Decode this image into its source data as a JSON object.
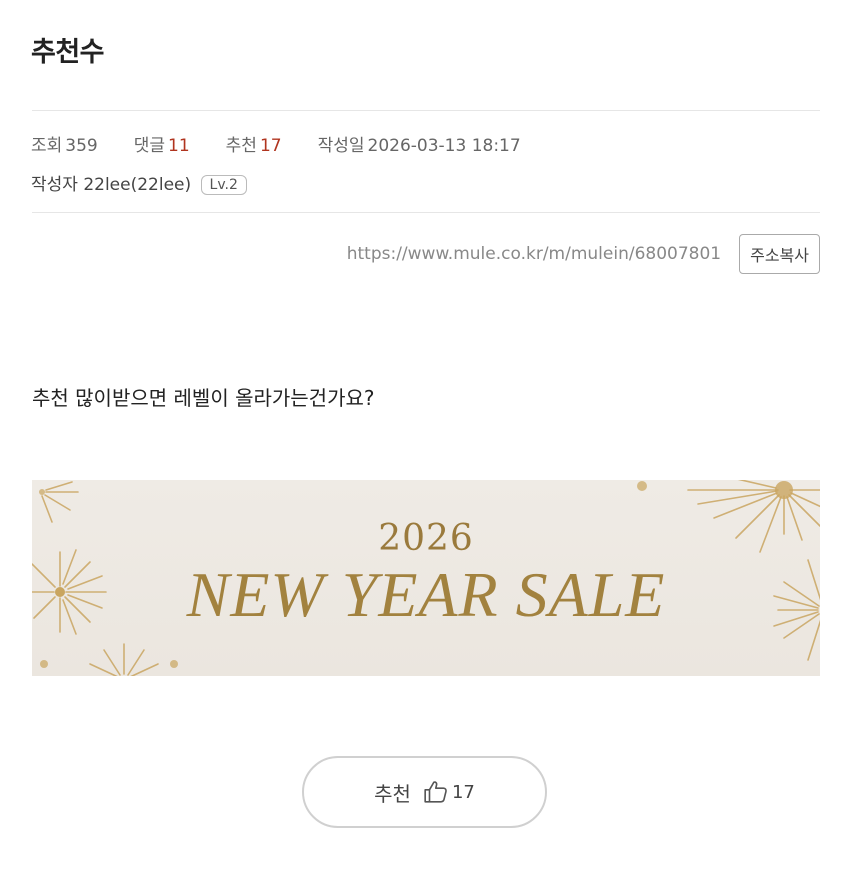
{
  "post": {
    "title": "추천수",
    "views_label": "조회",
    "views": "359",
    "comments_label": "댓글",
    "comments": "11",
    "recommends_label": "추천",
    "recommends": "17",
    "date_label": "작성일",
    "date": "2026-03-13 18:17",
    "author_label": "작성자",
    "author": "22lee(22lee)",
    "level": "Lv.2",
    "url": "https://www.mule.co.kr/m/mulein/68007801",
    "copy_label": "주소복사",
    "body": "추천 많이받으면 레벨이 올라가는건가요?"
  },
  "banner": {
    "year": "2026",
    "text": "NEW YEAR SALE",
    "color": "#a2823f",
    "background": "#ece7e0"
  },
  "recommend_button": {
    "label": "추천",
    "icon": "thumbs-up-icon",
    "count": "17"
  }
}
